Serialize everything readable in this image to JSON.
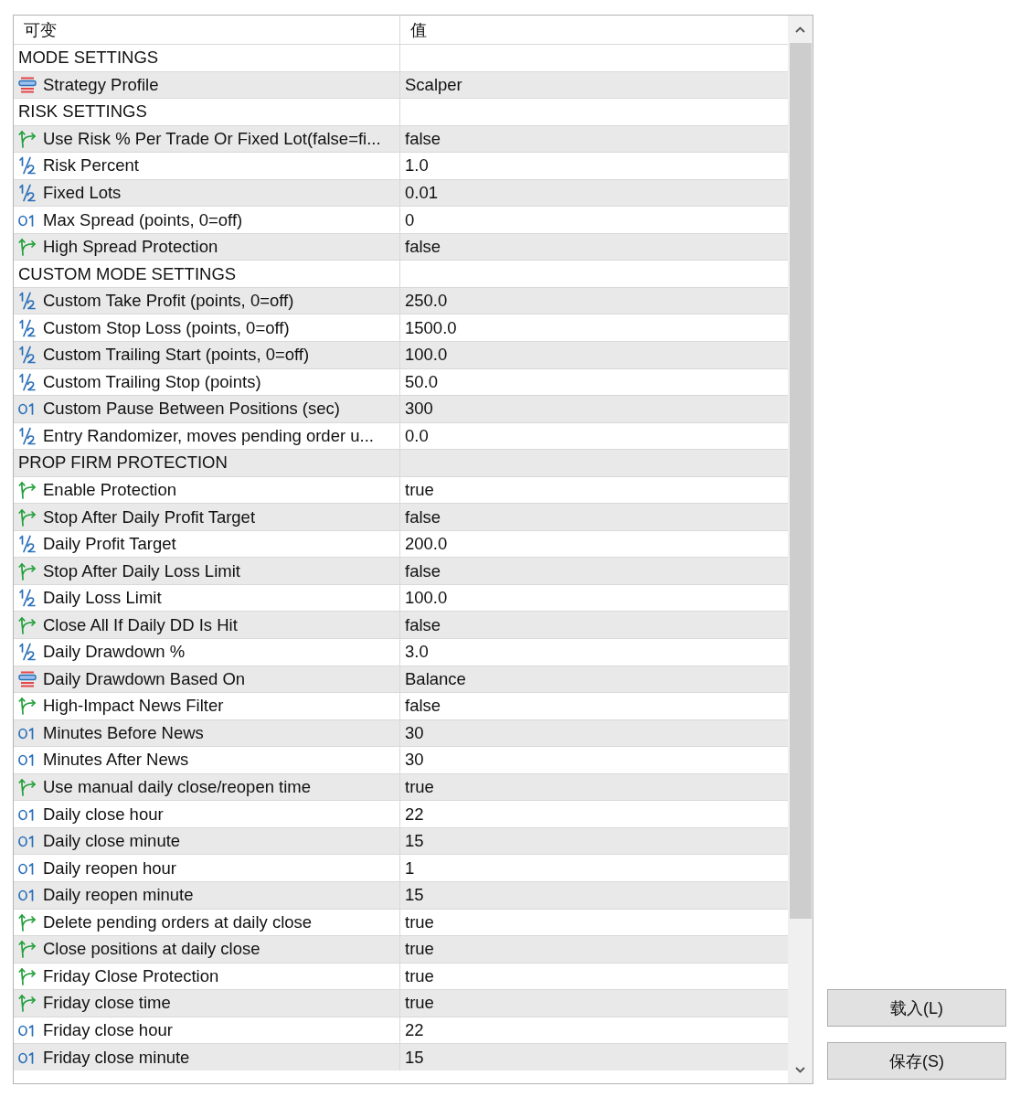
{
  "columns": [
    "可变",
    "值"
  ],
  "rows": [
    {
      "kind": "section",
      "label": "MODE SETTINGS"
    },
    {
      "kind": "enum",
      "name": "Strategy Profile",
      "value": "Scalper"
    },
    {
      "kind": "section",
      "label": "RISK SETTINGS"
    },
    {
      "kind": "bool",
      "name": "Use Risk % Per Trade Or Fixed Lot(false=fi...",
      "value": "false"
    },
    {
      "kind": "double",
      "name": "Risk Percent",
      "value": "1.0"
    },
    {
      "kind": "double",
      "name": "Fixed Lots",
      "value": "0.01"
    },
    {
      "kind": "int",
      "name": "Max Spread (points, 0=off)",
      "value": "0"
    },
    {
      "kind": "bool",
      "name": "High Spread Protection",
      "value": "false"
    },
    {
      "kind": "section",
      "label": "CUSTOM MODE SETTINGS"
    },
    {
      "kind": "double",
      "name": "Custom Take Profit (points, 0=off)",
      "value": "250.0"
    },
    {
      "kind": "double",
      "name": "Custom Stop Loss (points, 0=off)",
      "value": "1500.0"
    },
    {
      "kind": "double",
      "name": "Custom Trailing Start (points, 0=off)",
      "value": "100.0"
    },
    {
      "kind": "double",
      "name": "Custom Trailing Stop (points)",
      "value": "50.0"
    },
    {
      "kind": "int",
      "name": "Custom Pause Between Positions (sec)",
      "value": "300"
    },
    {
      "kind": "double",
      "name": "Entry Randomizer, moves pending order u...",
      "value": "0.0"
    },
    {
      "kind": "section",
      "label": "PROP FIRM PROTECTION"
    },
    {
      "kind": "bool",
      "name": "Enable Protection",
      "value": "true"
    },
    {
      "kind": "bool",
      "name": "Stop After Daily Profit Target",
      "value": "false"
    },
    {
      "kind": "double",
      "name": "Daily Profit Target",
      "value": "200.0"
    },
    {
      "kind": "bool",
      "name": "Stop After Daily Loss Limit",
      "value": "false"
    },
    {
      "kind": "double",
      "name": "Daily Loss Limit",
      "value": "100.0"
    },
    {
      "kind": "bool",
      "name": "Close All If Daily DD Is Hit",
      "value": "false"
    },
    {
      "kind": "double",
      "name": "Daily Drawdown %",
      "value": "3.0"
    },
    {
      "kind": "enum",
      "name": "Daily Drawdown Based On",
      "value": "Balance"
    },
    {
      "kind": "bool",
      "name": "High-Impact News Filter",
      "value": "false"
    },
    {
      "kind": "int",
      "name": "Minutes Before News",
      "value": "30"
    },
    {
      "kind": "int",
      "name": "Minutes After News",
      "value": "30"
    },
    {
      "kind": "bool",
      "name": "Use manual daily close/reopen time",
      "value": "true"
    },
    {
      "kind": "int",
      "name": "Daily close hour",
      "value": "22"
    },
    {
      "kind": "int",
      "name": "Daily close minute",
      "value": "15"
    },
    {
      "kind": "int",
      "name": "Daily reopen hour",
      "value": "1"
    },
    {
      "kind": "int",
      "name": "Daily reopen minute",
      "value": "15"
    },
    {
      "kind": "bool",
      "name": "Delete pending orders at daily close",
      "value": "true"
    },
    {
      "kind": "bool",
      "name": "Close positions at daily close",
      "value": "true"
    },
    {
      "kind": "bool",
      "name": "Friday Close Protection",
      "value": "true"
    },
    {
      "kind": "bool",
      "name": "Friday close time",
      "value": "true"
    },
    {
      "kind": "int",
      "name": "Friday close hour",
      "value": "22"
    },
    {
      "kind": "int",
      "name": "Friday close minute",
      "value": "15"
    }
  ],
  "buttons": [
    "载入(L)",
    "保存(S)"
  ]
}
